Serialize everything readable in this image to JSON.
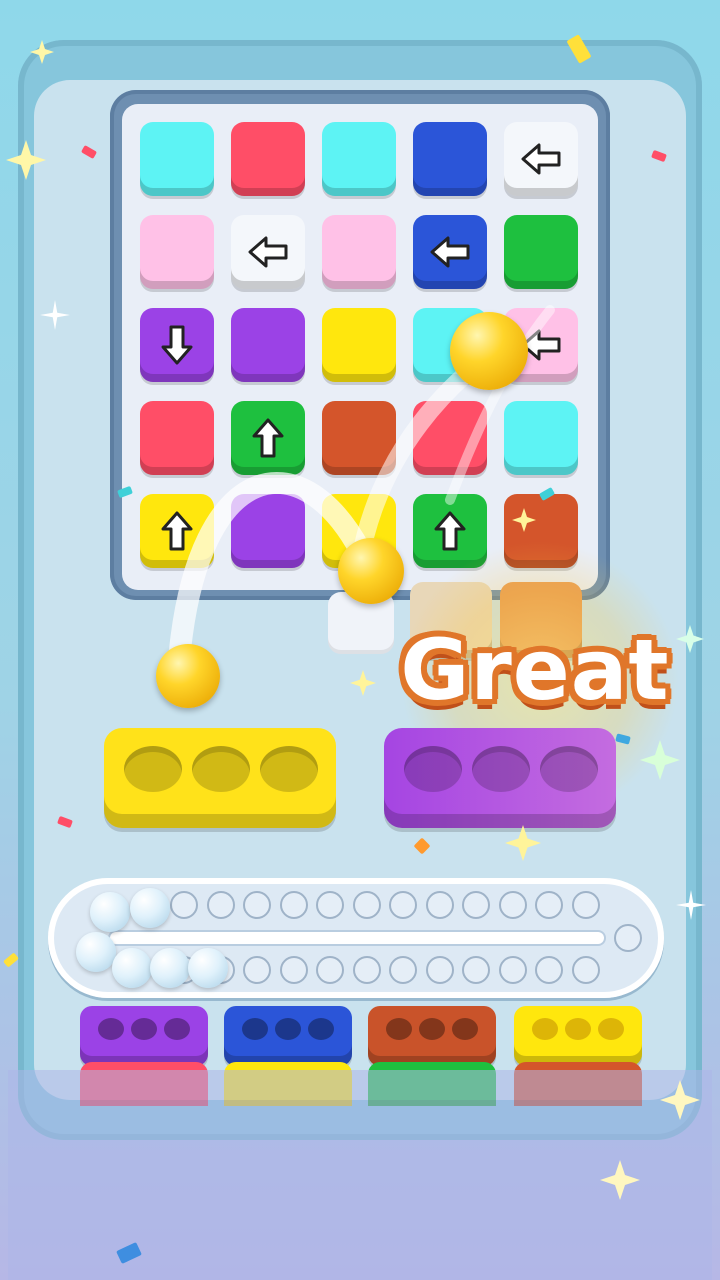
{
  "colors": {
    "cyan": "#5df3f4",
    "red": "#ff4e67",
    "blue": "#2b55d8",
    "white": "#f4f7fb",
    "pink": "#ffc1e7",
    "green": "#1ec03f",
    "purple": "#9b42e6",
    "yellow": "#ffe70d",
    "rust": "#d4552b",
    "ghost": "#f0f3f9"
  },
  "board": {
    "tiles": [
      {
        "color": "cyan",
        "arrow": "none"
      },
      {
        "color": "red",
        "arrow": "none"
      },
      {
        "color": "cyan",
        "arrow": "none"
      },
      {
        "color": "blue",
        "arrow": "none"
      },
      {
        "color": "white",
        "arrow": "left"
      },
      {
        "color": "pink",
        "arrow": "none"
      },
      {
        "color": "white",
        "arrow": "left"
      },
      {
        "color": "pink",
        "arrow": "none"
      },
      {
        "color": "blue",
        "arrow": "left"
      },
      {
        "color": "green",
        "arrow": "none"
      },
      {
        "color": "purple",
        "arrow": "down"
      },
      {
        "color": "purple",
        "arrow": "none"
      },
      {
        "color": "yellow",
        "arrow": "none"
      },
      {
        "color": "cyan",
        "arrow": "none"
      },
      {
        "color": "pink",
        "arrow": "left"
      },
      {
        "color": "red",
        "arrow": "none"
      },
      {
        "color": "green",
        "arrow": "up"
      },
      {
        "color": "rust",
        "arrow": "none"
      },
      {
        "color": "red",
        "arrow": "none"
      },
      {
        "color": "cyan",
        "arrow": "none"
      },
      {
        "color": "yellow",
        "arrow": "up"
      },
      {
        "color": "purple",
        "arrow": "none"
      },
      {
        "color": "yellow",
        "arrow": "none"
      },
      {
        "color": "green",
        "arrow": "up"
      },
      {
        "color": "rust",
        "arrow": "none"
      }
    ]
  },
  "feedback": {
    "message": "Great"
  },
  "holders": {
    "big": [
      {
        "color": "yellow",
        "holes": 3,
        "filled": 0
      },
      {
        "color": "purple",
        "holes": 3,
        "filled": 0
      }
    ],
    "queue": [
      {
        "color": "purple",
        "holes": 3
      },
      {
        "color": "blue",
        "holes": 3
      },
      {
        "color": "rust",
        "holes": 3
      },
      {
        "color": "yellow",
        "holes": 3
      }
    ],
    "trays": [
      "red",
      "yellow",
      "green",
      "rust"
    ]
  },
  "conveyor": {
    "slots_per_row": 12,
    "pearls_loaded": 6
  },
  "icons": [
    "arrow-left-icon",
    "arrow-up-icon",
    "arrow-down-icon",
    "sparkle-icon",
    "gold-ball-icon"
  ]
}
